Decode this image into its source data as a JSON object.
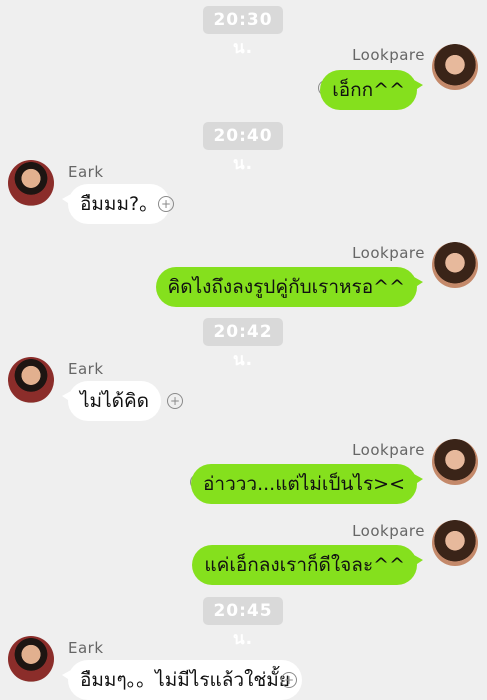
{
  "timestamps": [
    "20:30 น.",
    "20:40 น.",
    "20:42 น.",
    "20:45 น."
  ],
  "users": {
    "lookpare": "Lookpare",
    "eark": "Eark"
  },
  "messages": [
    {
      "sender": "Lookpare",
      "text": "เอ็กก^^"
    },
    {
      "sender": "Eark",
      "text": "อืมมม?。"
    },
    {
      "sender": "Lookpare",
      "text": "คิดไงถึงลงรูปคู่กับเราหรอ^^"
    },
    {
      "sender": "Eark",
      "text": "ไม่ได้คิด"
    },
    {
      "sender": "Lookpare",
      "text": "อ่าววว...แต่ไม่เป็นไร><"
    },
    {
      "sender": "Lookpare",
      "text": "แค่เอ็กลงเราก็ดีใจละ^^"
    },
    {
      "sender": "Eark",
      "text": "อืมมๆ。。ไม่มีไรแล้วใช่มั้ย"
    }
  ],
  "icons": {
    "add": "plus-circle-icon"
  },
  "colors": {
    "background": "#efefef",
    "sent_bubble": "#85e01d",
    "received_bubble": "#ffffff",
    "timestamp_bg": "#d9d9d9"
  }
}
